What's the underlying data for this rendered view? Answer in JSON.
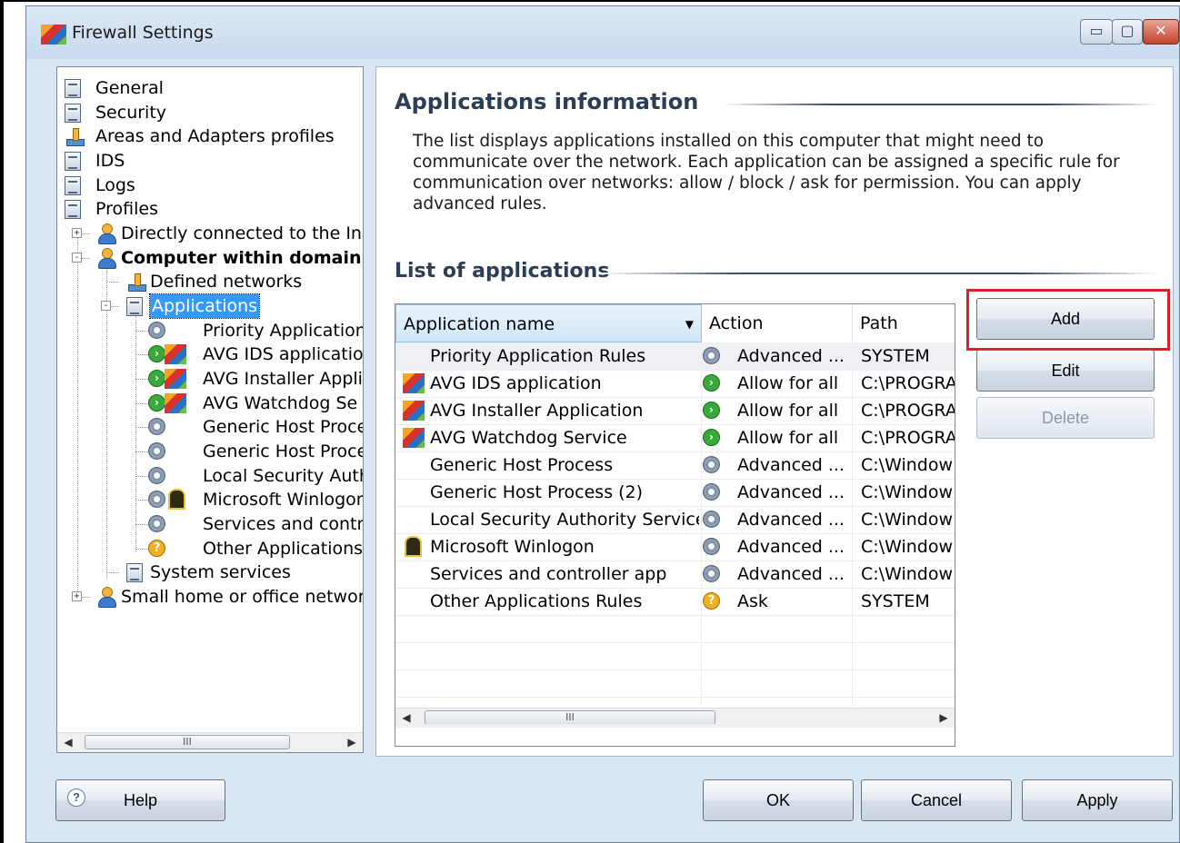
{
  "window": {
    "title": "Firewall Settings",
    "controls": {
      "minimize": "▭",
      "maximize": "▢",
      "close": "✕"
    }
  },
  "tree": {
    "items": [
      {
        "label": "General",
        "icon": "document-icon"
      },
      {
        "label": "Security",
        "icon": "document-icon"
      },
      {
        "label": "Areas and Adapters profiles",
        "icon": "network-icon"
      },
      {
        "label": "IDS",
        "icon": "document-icon"
      },
      {
        "label": "Logs",
        "icon": "document-icon"
      },
      {
        "label": "Profiles",
        "icon": "document-icon"
      },
      {
        "label": "Directly connected to the In",
        "icon": "user-icon",
        "expander": "+"
      },
      {
        "label": "Computer within domain",
        "icon": "user-icon",
        "expander": "−"
      },
      {
        "label": "Defined networks",
        "icon": "network-icon"
      },
      {
        "label": "Applications",
        "icon": "document-icon",
        "expander": "−"
      },
      {
        "label": "Priority Application",
        "icon": "gear-icon"
      },
      {
        "label": "AVG IDS applicatio",
        "icon": "allow-avg-icon"
      },
      {
        "label": "AVG Installer Applic",
        "icon": "allow-avg-icon"
      },
      {
        "label": "AVG Watchdog Se",
        "icon": "allow-avg-icon"
      },
      {
        "label": "Generic Host Proce",
        "icon": "gear-icon"
      },
      {
        "label": "Generic Host Proce",
        "icon": "gear-icon"
      },
      {
        "label": "Local Security Auth",
        "icon": "gear-icon"
      },
      {
        "label": "Microsoft Winlogon",
        "icon": "gear-winlogon-icon"
      },
      {
        "label": "Services and contr",
        "icon": "gear-icon"
      },
      {
        "label": "Other Applications",
        "icon": "question-icon"
      },
      {
        "label": "System services",
        "icon": "document-icon"
      },
      {
        "label": "Small home or office networl",
        "icon": "user-icon",
        "expander": "+"
      }
    ],
    "scroll_thumb": "III"
  },
  "main": {
    "info_title": "Applications information",
    "info_text": "The list displays applications installed on this computer that might need to communicate over the network. Each application can be assigned a specific rule for communication over networks: allow / block / ask for permission. You can apply advanced rules.",
    "list_title": "List of applications",
    "columns": [
      "Application name",
      "Action",
      "Path"
    ],
    "rows": [
      {
        "name": "Priority Application Rules",
        "action": "Advanced ...",
        "path": "SYSTEM",
        "icon": "",
        "action_icon": "gear-icon"
      },
      {
        "name": "AVG IDS application",
        "action": "Allow for all",
        "path": "C:\\PROGRA",
        "icon": "avg-icon",
        "action_icon": "allow-icon"
      },
      {
        "name": "AVG Installer Application",
        "action": "Allow for all",
        "path": "C:\\PROGRA",
        "icon": "avg-icon",
        "action_icon": "allow-icon"
      },
      {
        "name": "AVG Watchdog Service",
        "action": "Allow for all",
        "path": "C:\\PROGRA",
        "icon": "avg-icon",
        "action_icon": "allow-icon"
      },
      {
        "name": "Generic Host Process",
        "action": "Advanced ...",
        "path": "C:\\Window",
        "icon": "",
        "action_icon": "gear-icon"
      },
      {
        "name": "Generic Host Process (2)",
        "action": "Advanced ...",
        "path": "C:\\Window",
        "icon": "",
        "action_icon": "gear-icon"
      },
      {
        "name": "Local Security Authority Service",
        "action": "Advanced ...",
        "path": "C:\\Window",
        "icon": "",
        "action_icon": "gear-icon"
      },
      {
        "name": "Microsoft Winlogon",
        "action": "Advanced ...",
        "path": "C:\\Window",
        "icon": "winlogon-icon",
        "action_icon": "gear-icon"
      },
      {
        "name": "Services and controller app",
        "action": "Advanced ...",
        "path": "C:\\Window",
        "icon": "",
        "action_icon": "gear-icon"
      },
      {
        "name": "Other Applications Rules",
        "action": "Ask",
        "path": "SYSTEM",
        "icon": "",
        "action_icon": "question-icon"
      }
    ],
    "scroll_thumb": "III",
    "buttons": {
      "add": "Add",
      "edit": "Edit",
      "delete": "Delete"
    }
  },
  "footer": {
    "help": "Help",
    "ok": "OK",
    "cancel": "Cancel",
    "apply": "Apply"
  },
  "colors": {
    "highlight": "#e01e26",
    "selection": "#3399ff",
    "window_bg": "#d9e6f4"
  }
}
